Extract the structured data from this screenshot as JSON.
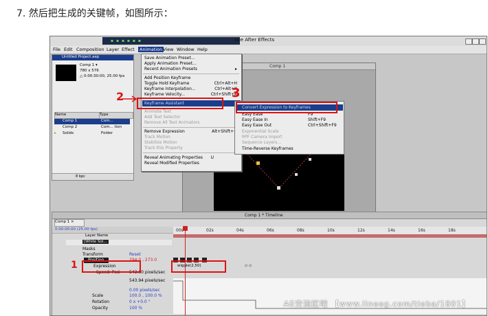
{
  "step_caption": "7. 然后把生成的关键帧，如图所示：",
  "app": {
    "title": "obe After Effects",
    "menubar": [
      "File",
      "Edit",
      "Composition",
      "Layer",
      "Effect",
      "Animation",
      "View",
      "Window",
      "Help"
    ],
    "active_menu": "Animation"
  },
  "project": {
    "title": "Untitled Project.aep",
    "info_name": "Comp 1 ▾",
    "info_size": "780 x 576",
    "info_dur": "△ 0:00:30:00, 25.00 fps",
    "col_name": "Name",
    "col_type": "Type",
    "items": [
      {
        "name": "Comp 1",
        "type": "Com..."
      },
      {
        "name": "Comp 2",
        "type": "Com... tion"
      },
      {
        "name": "Solids",
        "type": "Folder"
      }
    ],
    "footer": "8 bpc"
  },
  "comp_window": {
    "title": "Comp 1"
  },
  "animation_menu": {
    "items": [
      {
        "label": "Save Animation Preset...",
        "shortcut": "",
        "dim": false
      },
      {
        "label": "Apply Animation Preset...",
        "shortcut": "",
        "dim": false
      },
      {
        "label": "Recent Animation Presets",
        "shortcut": "▸",
        "dim": false
      },
      {
        "label": "Add Position Keyframe",
        "shortcut": "",
        "dim": false
      },
      {
        "label": "Toggle Hold Keyframe",
        "shortcut": "Ctrl+Alt+H",
        "dim": false
      },
      {
        "label": "Keyframe Interpolation...",
        "shortcut": "Ctrl+Alt+K",
        "dim": false
      },
      {
        "label": "Keyframe Velocity...",
        "shortcut": "Ctrl+Shift+K",
        "dim": false
      },
      {
        "label": "Keyframe Assistant",
        "shortcut": "▸",
        "dim": false
      },
      {
        "label": "Animate Text",
        "shortcut": "",
        "dim": true
      },
      {
        "label": "Add Text Selector",
        "shortcut": "",
        "dim": true
      },
      {
        "label": "Remove All Text Animators",
        "shortcut": "",
        "dim": true
      },
      {
        "label": "Remove Expression",
        "shortcut": "Alt+Shift+=",
        "dim": false
      },
      {
        "label": "Track Motion",
        "shortcut": "",
        "dim": true
      },
      {
        "label": "Stabilize Motion",
        "shortcut": "",
        "dim": true
      },
      {
        "label": "Track this Property",
        "shortcut": "",
        "dim": true
      },
      {
        "label": "Reveal Animating Properties",
        "shortcut": "U",
        "dim": false
      },
      {
        "label": "Reveal Modified Properties",
        "shortcut": "",
        "dim": false
      }
    ]
  },
  "assistant_submenu": {
    "items": [
      {
        "label": "Convert Expression to Keyframes",
        "shortcut": "",
        "dim": false
      },
      {
        "label": "Easy Ease",
        "shortcut": "F9",
        "dim": false
      },
      {
        "label": "Easy Ease In",
        "shortcut": "Shift+F9",
        "dim": false
      },
      {
        "label": "Easy Ease Out",
        "shortcut": "Ctrl+Shift+F9",
        "dim": false
      },
      {
        "label": "Exponential Scale",
        "shortcut": "",
        "dim": true
      },
      {
        "label": "RPF Camera Import",
        "shortcut": "",
        "dim": true
      },
      {
        "label": "Sequence Layers...",
        "shortcut": "",
        "dim": true
      },
      {
        "label": "Time-Reverse Keyframes",
        "shortcut": "",
        "dim": false
      }
    ]
  },
  "timeline": {
    "title": "Comp 1 * Timeline",
    "tab": "Comp 1 ×",
    "time": "0:00:00:00 (25.00 fps)",
    "ruler_ticks": [
      "00s",
      "02s",
      "04s",
      "06s",
      "08s",
      "10s",
      "12s",
      "14s",
      "16s",
      "18s"
    ],
    "layer_col": "Layer Name",
    "layer": "[White Sol...",
    "masks": "Masks",
    "transform": "Transform",
    "reset": "Reset",
    "position": "Position",
    "position_value": "294.0 , 273.0",
    "expression": "Expression",
    "speed_label": "Speed: Posi",
    "speed_top": "543.60 pixels/sec",
    "speed_mid": "543.94 pixels/sec",
    "speed_bot": "0.00 pixels/sec",
    "scale": "Scale",
    "scale_value": "100.0 , 100.0 %",
    "rotation": "Rotation",
    "rotation_value": "0 x +0.0 °",
    "opacity": "Opacity",
    "opacity_value": "100 %",
    "expr_text": "wiggle(2,50)"
  },
  "annotations": [
    "2",
    "3",
    "1"
  ],
  "watermark": "AE交流区吧 【www.lineeg.com/tieba/1801】"
}
